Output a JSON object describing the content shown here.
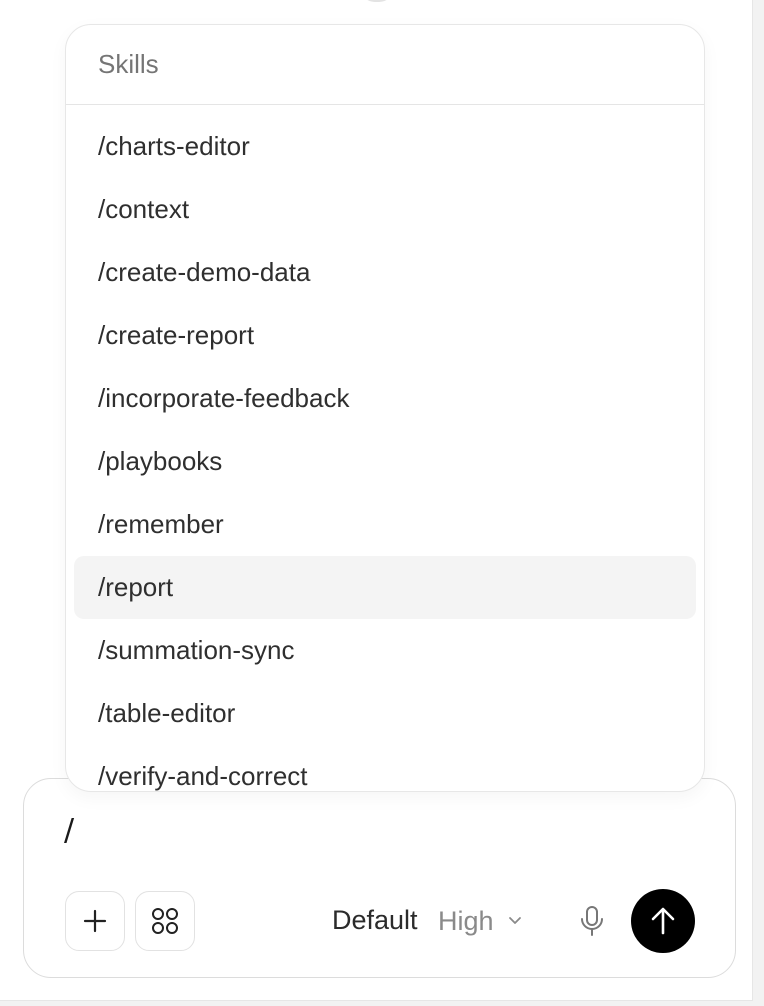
{
  "skills": {
    "header": "Skills",
    "items": [
      "/charts-editor",
      "/context",
      "/create-demo-data",
      "/create-report",
      "/incorporate-feedback",
      "/playbooks",
      "/remember",
      "/report",
      "/summation-sync",
      "/table-editor",
      "/verify-and-correct"
    ],
    "highlighted": "/report"
  },
  "composer": {
    "input_text": "/",
    "mode": "Default",
    "effort": "High",
    "icons": {
      "plus": "plus-icon",
      "apps": "apps-grid-icon",
      "chevron": "chevron-down-icon",
      "mic": "microphone-icon",
      "send": "arrow-up-icon"
    }
  },
  "colors": {
    "send_button": "#000000",
    "highlight_row": "#f4f4f4",
    "muted_text": "#8a8a8a"
  }
}
